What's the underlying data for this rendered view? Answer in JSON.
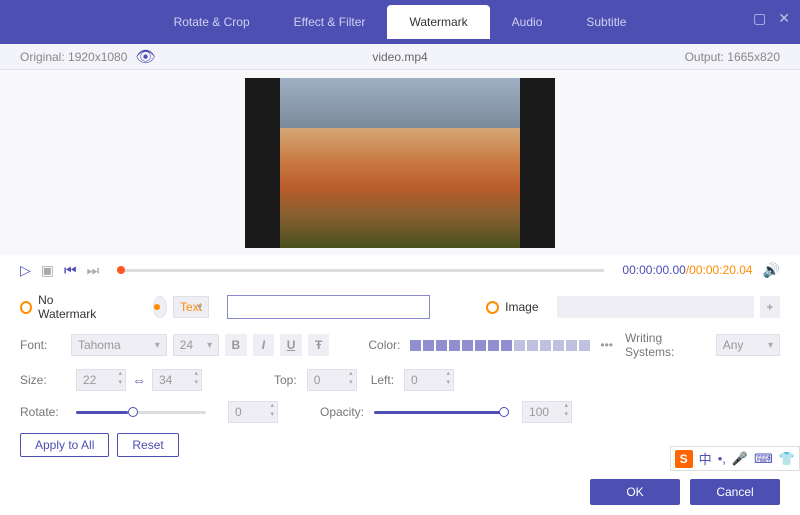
{
  "tabs": [
    "Rotate & Crop",
    "Effect & Filter",
    "Watermark",
    "Audio",
    "Subtitle"
  ],
  "activeTab": 2,
  "info": {
    "original": "Original:  1920x1080",
    "filename": "video.mp4",
    "output": "Output:  1665x820"
  },
  "time": {
    "current": "00:00:00.00",
    "total": "/00:00:20.04"
  },
  "wm": {
    "noWatermark": "No Watermark",
    "textLabel": "Text",
    "textValue": "",
    "imageLabel": "Image",
    "imageValue": ""
  },
  "font": {
    "label": "Font:",
    "family": "Tahoma",
    "size": "24",
    "b": "B",
    "i": "I",
    "u": "U",
    "s": "Ŧ"
  },
  "color": {
    "label": "Color:"
  },
  "writing": {
    "label": "Writing Systems:",
    "value": "Any"
  },
  "size": {
    "label": "Size:",
    "w": "22",
    "h": "34"
  },
  "pos": {
    "topLabel": "Top:",
    "top": "0",
    "leftLabel": "Left:",
    "left": "0"
  },
  "rotate": {
    "label": "Rotate:",
    "value": "0"
  },
  "opacity": {
    "label": "Opacity:",
    "value": "100"
  },
  "actions": {
    "applyAll": "Apply to All",
    "reset": "Reset",
    "ok": "OK",
    "cancel": "Cancel"
  },
  "ime": {
    "s": "S"
  }
}
